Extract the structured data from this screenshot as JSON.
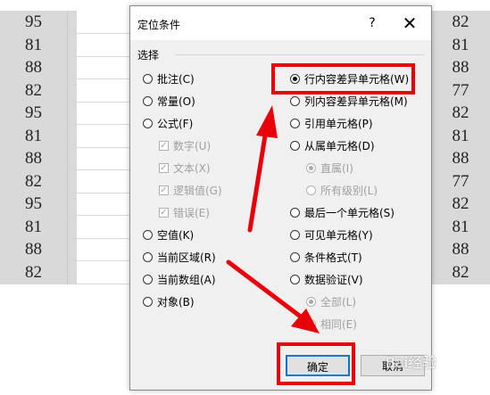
{
  "sheet": {
    "left_values": [
      "95",
      "81",
      "88",
      "82",
      "95",
      "81",
      "88",
      "82",
      "95",
      "81",
      "88",
      "82"
    ],
    "right_values": [
      "82",
      "81",
      "88",
      "77",
      "82",
      "81",
      "88",
      "77",
      "82",
      "81",
      "88",
      "82"
    ]
  },
  "dialog": {
    "title": "定位条件",
    "help_label": "?",
    "close_label": "✕",
    "group_label": "选择",
    "left_options": [
      {
        "label": "批注(C)",
        "state": "off"
      },
      {
        "label": "常量(O)",
        "state": "off"
      },
      {
        "label": "公式(F)",
        "state": "off"
      }
    ],
    "formula_sub": [
      {
        "label": "数字(U)"
      },
      {
        "label": "文本(X)"
      },
      {
        "label": "逻辑值(G)"
      },
      {
        "label": "错误(E)"
      }
    ],
    "left_options2": [
      {
        "label": "空值(K)"
      },
      {
        "label": "当前区域(R)"
      },
      {
        "label": "当前数组(A)"
      },
      {
        "label": "对象(B)"
      }
    ],
    "right_options": [
      {
        "label": "行内容差异单元格(W)",
        "state": "on"
      },
      {
        "label": "列内容差异单元格(M)",
        "state": "off"
      },
      {
        "label": "引用单元格(P)",
        "state": "off"
      },
      {
        "label": "从属单元格(D)",
        "state": "off"
      }
    ],
    "dependent_sub": [
      {
        "label": "直属(I)",
        "state": "on"
      },
      {
        "label": "所有级别(L)",
        "state": "off"
      }
    ],
    "right_options2": [
      {
        "label": "最后一个单元格(S)"
      },
      {
        "label": "可见单元格(Y)"
      },
      {
        "label": "条件格式(T)"
      },
      {
        "label": "数据验证(V)"
      }
    ],
    "validation_sub": [
      {
        "label": "全部(L)",
        "state": "on"
      },
      {
        "label": "相同(E)",
        "state": "off"
      }
    ],
    "ok_label": "确定",
    "cancel_label": "取消"
  },
  "watermark": "Bai经验",
  "colors": {
    "highlight": "#e8000b",
    "arrow": "#e8000b",
    "primary_border": "#0078d7"
  }
}
